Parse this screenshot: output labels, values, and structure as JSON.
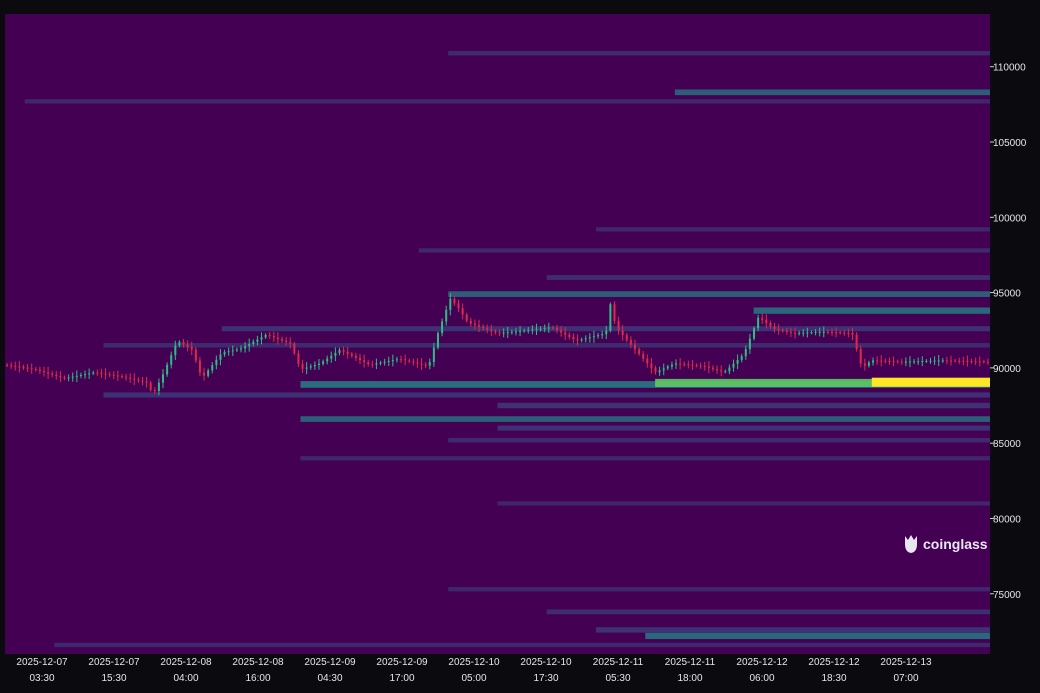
{
  "watermark": {
    "text": "coinglass"
  },
  "chart_data": {
    "type": "heatmap",
    "title": "",
    "xlabel": "",
    "ylabel": "",
    "ylim": [
      71000,
      113500
    ],
    "grid": false,
    "legend": "none",
    "colors": {
      "background": "#440154",
      "band_low": "#3b528b",
      "band_mid": "#21918c",
      "band_high": "#5ec962",
      "band_max": "#fde725",
      "candle_up": "#2ebd85",
      "candle_down": "#e0294a",
      "text": "#e6e6e6"
    },
    "y_ticks": [
      "75000",
      "80000",
      "85000",
      "90000",
      "95000",
      "100000",
      "105000",
      "110000"
    ],
    "y_tick_values": [
      75000,
      80000,
      85000,
      90000,
      95000,
      100000,
      105000,
      110000
    ],
    "x_ticks": [
      {
        "date": "2025-12-07",
        "time": "03:30"
      },
      {
        "date": "2025-12-07",
        "time": "15:30"
      },
      {
        "date": "2025-12-08",
        "time": "04:00"
      },
      {
        "date": "2025-12-08",
        "time": "16:00"
      },
      {
        "date": "2025-12-09",
        "time": "04:30"
      },
      {
        "date": "2025-12-09",
        "time": "17:00"
      },
      {
        "date": "2025-12-10",
        "time": "05:00"
      },
      {
        "date": "2025-12-10",
        "time": "17:30"
      },
      {
        "date": "2025-12-11",
        "time": "05:30"
      },
      {
        "date": "2025-12-11",
        "time": "18:00"
      },
      {
        "date": "2025-12-12",
        "time": "06:00"
      },
      {
        "date": "2025-12-12",
        "time": "18:30"
      },
      {
        "date": "2025-12-13",
        "time": "07:00"
      }
    ],
    "liquidity_bands": [
      {
        "price": 110900,
        "start": 0.45,
        "intensity": 0.25
      },
      {
        "price": 108300,
        "start": 0.68,
        "intensity": 0.45
      },
      {
        "price": 107700,
        "start": 0.02,
        "intensity": 0.2
      },
      {
        "price": 99200,
        "start": 0.6,
        "intensity": 0.2
      },
      {
        "price": 97800,
        "start": 0.42,
        "intensity": 0.22
      },
      {
        "price": 96000,
        "start": 0.55,
        "intensity": 0.3
      },
      {
        "price": 94900,
        "start": 0.45,
        "intensity": 0.45
      },
      {
        "price": 93800,
        "start": 0.76,
        "intensity": 0.55
      },
      {
        "price": 92600,
        "start": 0.22,
        "intensity": 0.35
      },
      {
        "price": 91500,
        "start": 0.1,
        "intensity": 0.25
      },
      {
        "price": 88900,
        "start": 0.3,
        "intensity": 0.62
      },
      {
        "price": 89000,
        "start": 0.66,
        "intensity": 0.85
      },
      {
        "price": 89050,
        "start": 0.88,
        "intensity": 1.0
      },
      {
        "price": 88200,
        "start": 0.1,
        "intensity": 0.35
      },
      {
        "price": 87500,
        "start": 0.5,
        "intensity": 0.4
      },
      {
        "price": 86600,
        "start": 0.3,
        "intensity": 0.45
      },
      {
        "price": 86000,
        "start": 0.5,
        "intensity": 0.35
      },
      {
        "price": 85200,
        "start": 0.45,
        "intensity": 0.25
      },
      {
        "price": 84000,
        "start": 0.3,
        "intensity": 0.2
      },
      {
        "price": 81000,
        "start": 0.5,
        "intensity": 0.18
      },
      {
        "price": 75300,
        "start": 0.45,
        "intensity": 0.2
      },
      {
        "price": 73800,
        "start": 0.55,
        "intensity": 0.3
      },
      {
        "price": 72600,
        "start": 0.6,
        "intensity": 0.4
      },
      {
        "price": 72200,
        "start": 0.65,
        "intensity": 0.55
      },
      {
        "price": 71600,
        "start": 0.05,
        "intensity": 0.22
      }
    ],
    "price_path": [
      [
        0.0,
        90200
      ],
      [
        0.03,
        89900
      ],
      [
        0.06,
        89300
      ],
      [
        0.09,
        89700
      ],
      [
        0.12,
        89400
      ],
      [
        0.145,
        89000
      ],
      [
        0.15,
        88200
      ],
      [
        0.16,
        89500
      ],
      [
        0.175,
        91800
      ],
      [
        0.19,
        91200
      ],
      [
        0.2,
        89300
      ],
      [
        0.22,
        91000
      ],
      [
        0.24,
        91300
      ],
      [
        0.265,
        92200
      ],
      [
        0.29,
        91600
      ],
      [
        0.3,
        89900
      ],
      [
        0.32,
        90300
      ],
      [
        0.34,
        91200
      ],
      [
        0.37,
        90200
      ],
      [
        0.4,
        90600
      ],
      [
        0.43,
        90100
      ],
      [
        0.44,
        92400
      ],
      [
        0.452,
        94600
      ],
      [
        0.46,
        94000
      ],
      [
        0.47,
        93000
      ],
      [
        0.5,
        92300
      ],
      [
        0.53,
        92500
      ],
      [
        0.555,
        92700
      ],
      [
        0.58,
        91800
      ],
      [
        0.61,
        92300
      ],
      [
        0.615,
        94400
      ],
      [
        0.62,
        92700
      ],
      [
        0.64,
        91200
      ],
      [
        0.66,
        89700
      ],
      [
        0.68,
        90300
      ],
      [
        0.71,
        90100
      ],
      [
        0.73,
        89700
      ],
      [
        0.75,
        90900
      ],
      [
        0.765,
        93400
      ],
      [
        0.78,
        92600
      ],
      [
        0.8,
        92300
      ],
      [
        0.83,
        92400
      ],
      [
        0.86,
        92300
      ],
      [
        0.87,
        90000
      ],
      [
        0.88,
        90500
      ],
      [
        0.91,
        90400
      ],
      [
        0.95,
        90500
      ],
      [
        1.0,
        90400
      ]
    ]
  }
}
